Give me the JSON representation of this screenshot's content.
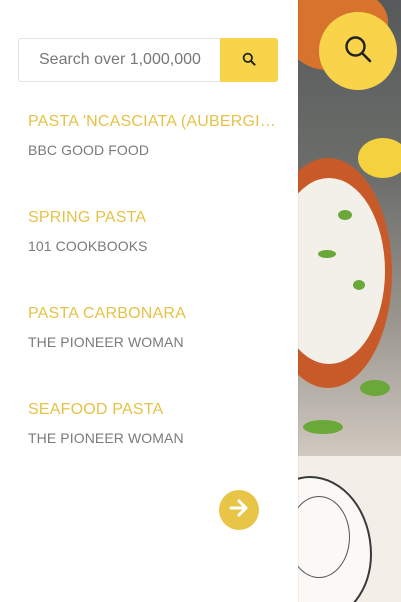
{
  "search": {
    "placeholder": "Search over 1,000,000",
    "button_icon": "search-icon"
  },
  "fab": {
    "icon": "search-icon"
  },
  "results": [
    {
      "title": "PASTA 'NCASCIATA (AUBERGINE BAKED PASTA)",
      "source": "BBC GOOD FOOD"
    },
    {
      "title": "SPRING PASTA",
      "source": "101 COOKBOOKS"
    },
    {
      "title": "PASTA CARBONARA",
      "source": "THE PIONEER WOMAN"
    },
    {
      "title": "SEAFOOD PASTA",
      "source": "THE PIONEER WOMAN"
    }
  ],
  "next_button": {
    "icon": "arrow-right-icon"
  },
  "colors": {
    "accent": "#f9d44b",
    "title": "#e5c247",
    "source": "#7a7a7a"
  }
}
